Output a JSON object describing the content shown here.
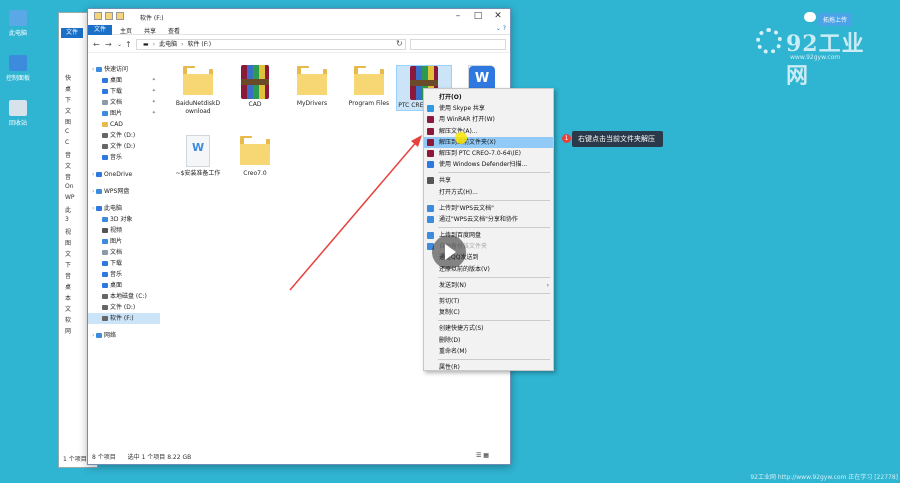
{
  "desktop": {
    "icons": [
      {
        "label": "此电脑",
        "icon": "computer-icon"
      },
      {
        "label": "控制面板",
        "icon": "control-panel-icon"
      },
      {
        "label": "回收站",
        "icon": "recycle-bin-icon"
      }
    ]
  },
  "brand": {
    "name": "92工业网",
    "url": "www.92gyw.com",
    "cloud_button": "拓拖上传"
  },
  "back_window": {
    "file_tab": "文件",
    "nav_items": [
      "快",
      "桌",
      "下",
      "文",
      "图",
      "C",
      "C",
      "音",
      "文",
      "音",
      "On",
      "WP",
      "此",
      "3",
      "视",
      "图",
      "文",
      "下",
      "音",
      "桌",
      "本",
      "文",
      "软",
      "网"
    ],
    "status": "1 个项目"
  },
  "window": {
    "title": "软件 (F:)",
    "ribbon_tabs": [
      "文件",
      "主页",
      "共享",
      "查看"
    ],
    "address": {
      "root": "此电脑",
      "current": "软件 (F:)"
    },
    "sidebar": [
      {
        "label": "快速访问",
        "level": 1,
        "icon": "star-icon",
        "color": "#3d8bdc"
      },
      {
        "label": "桌面",
        "level": 2,
        "icon": "desktop-icon",
        "color": "#2f78e0",
        "pin": true
      },
      {
        "label": "下载",
        "level": 2,
        "icon": "download-icon",
        "color": "#2f78e0",
        "pin": true
      },
      {
        "label": "文档",
        "level": 2,
        "icon": "document-icon",
        "color": "#8a9aa8",
        "pin": true
      },
      {
        "label": "图片",
        "level": 2,
        "icon": "picture-icon",
        "color": "#3d8bdc",
        "pin": true
      },
      {
        "label": "CAD",
        "level": 2,
        "icon": "folder-icon",
        "color": "#e8b94b"
      },
      {
        "label": "文件 (D:)",
        "level": 2,
        "icon": "drive-icon",
        "color": "#666"
      },
      {
        "label": "文件 (D:)",
        "level": 2,
        "icon": "drive-icon",
        "color": "#666"
      },
      {
        "label": "音乐",
        "level": 2,
        "icon": "music-icon",
        "color": "#2f78e0"
      },
      {
        "label": "OneDrive",
        "level": 1,
        "icon": "onedrive-icon",
        "color": "#2f78e0"
      },
      {
        "label": "WPS网盘",
        "level": 1,
        "icon": "wps-cloud-icon",
        "color": "#3d8bdc"
      },
      {
        "label": "此电脑",
        "level": 1,
        "icon": "computer-icon",
        "color": "#2f78e0"
      },
      {
        "label": "3D 对象",
        "level": 2,
        "icon": "3d-objects-icon",
        "color": "#3d8bdc"
      },
      {
        "label": "视频",
        "level": 2,
        "icon": "video-icon",
        "color": "#555"
      },
      {
        "label": "图片",
        "level": 2,
        "icon": "picture-icon",
        "color": "#3d8bdc"
      },
      {
        "label": "文档",
        "level": 2,
        "icon": "document-icon",
        "color": "#8a9aa8"
      },
      {
        "label": "下载",
        "level": 2,
        "icon": "download-icon",
        "color": "#2f78e0"
      },
      {
        "label": "音乐",
        "level": 2,
        "icon": "music-icon",
        "color": "#2f78e0"
      },
      {
        "label": "桌面",
        "level": 2,
        "icon": "desktop-icon",
        "color": "#2f78e0"
      },
      {
        "label": "本地磁盘 (C:)",
        "level": 2,
        "icon": "drive-icon",
        "color": "#666"
      },
      {
        "label": "文件 (D:)",
        "level": 2,
        "icon": "drive-icon",
        "color": "#666"
      },
      {
        "label": "软件 (F:)",
        "level": 2,
        "icon": "drive-icon",
        "color": "#666",
        "selected": true
      },
      {
        "label": "网络",
        "level": 1,
        "icon": "network-icon",
        "color": "#3d8bdc"
      }
    ],
    "files": [
      {
        "name": "BaiduNetdiskD ownload",
        "type": "folder"
      },
      {
        "name": "CAD",
        "type": "rar"
      },
      {
        "name": "MyDrivers",
        "type": "folder"
      },
      {
        "name": "Program Files",
        "type": "folder"
      },
      {
        "name": "PTC CREO-7.0-64",
        "type": "rar",
        "selected": true
      },
      {
        "name": "",
        "type": "wps"
      },
      {
        "name": "~$安装准备工作",
        "type": "doc"
      },
      {
        "name": "Creo7.0",
        "type": "folder"
      }
    ],
    "status": {
      "count": "8 个项目",
      "selected": "选中 1 个项目 8.22 GB"
    }
  },
  "context_menu": [
    {
      "label": "打开(O)",
      "bold": true
    },
    {
      "label": "使用 Skype 共享",
      "icon": "skype-icon",
      "color": "#2f9ae0"
    },
    {
      "label": "用 WinRAR 打开(W)",
      "icon": "winrar-icon",
      "color": "#8b1a3a"
    },
    {
      "label": "解压文件(A)...",
      "icon": "winrar-icon",
      "color": "#8b1a3a"
    },
    {
      "label": "解压到当前文件夹(X)",
      "icon": "winrar-icon",
      "color": "#8b1a3a",
      "hover": true
    },
    {
      "label": "解压到 PTC CREO-7.0-64\\(E)",
      "icon": "winrar-icon",
      "color": "#8b1a3a"
    },
    {
      "label": "使用 Windows Defender扫描...",
      "icon": "defender-icon",
      "color": "#2f78e0"
    },
    {
      "sep": true
    },
    {
      "label": "共享",
      "icon": "share-icon",
      "color": "#555"
    },
    {
      "label": "打开方式(H)..."
    },
    {
      "sep": true
    },
    {
      "label": "上传到\"WPS云文档\"",
      "icon": "wps-cloud-icon",
      "color": "#3d8bdc"
    },
    {
      "label": "通过\"WPS云文档\"分享和协作",
      "icon": "wps-share-icon",
      "color": "#3d8bdc"
    },
    {
      "sep": true
    },
    {
      "label": "上传到百度网盘",
      "icon": "baidu-icon",
      "color": "#3d8bdc"
    },
    {
      "label": "自动备份该文件夹",
      "icon": "baidu-icon",
      "color": "#3d8bdc",
      "dim": true
    },
    {
      "label": "通过QQ发送到"
    },
    {
      "label": "还原以前的版本(V)"
    },
    {
      "sep": true
    },
    {
      "label": "发送到(N)",
      "submenu": true
    },
    {
      "sep": true
    },
    {
      "label": "剪切(T)"
    },
    {
      "label": "复制(C)"
    },
    {
      "sep": true
    },
    {
      "label": "创建快捷方式(S)"
    },
    {
      "label": "删除(D)"
    },
    {
      "label": "重命名(M)"
    },
    {
      "sep": true
    },
    {
      "label": "属性(R)"
    }
  ],
  "annotation": {
    "number": "1",
    "text": "右键点击当前文件夹解压"
  },
  "footer": "92工业网 http://www.92gyw.com 正在学习 [22778]"
}
